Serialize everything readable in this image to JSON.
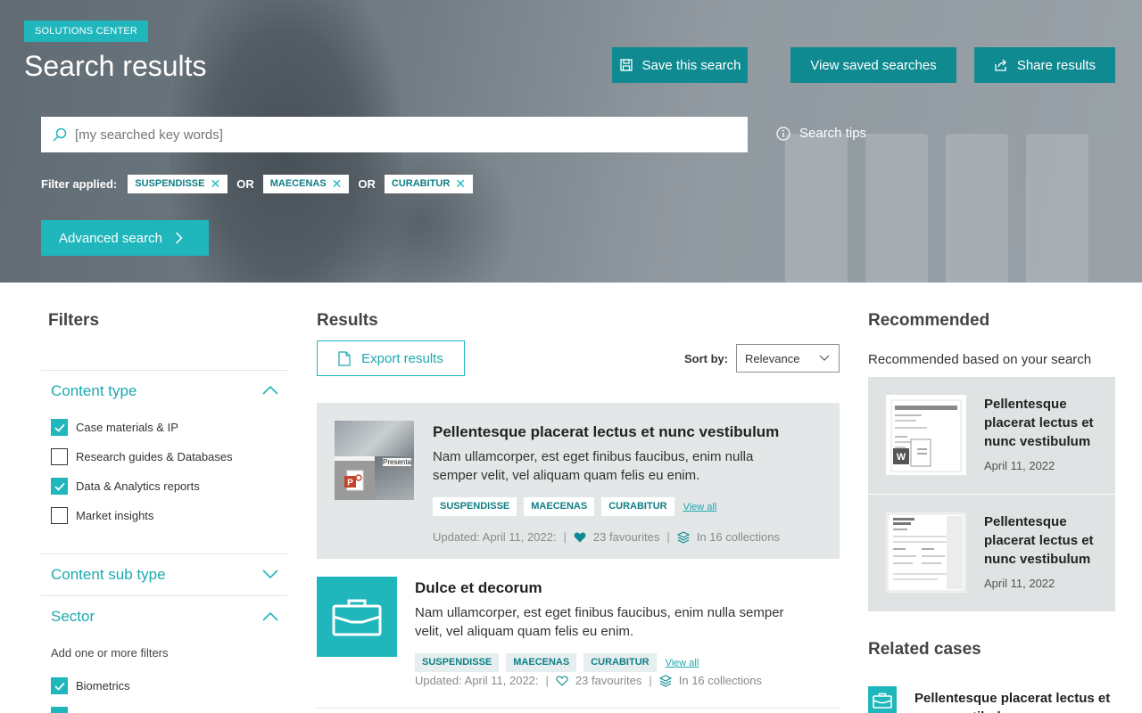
{
  "hero": {
    "badge": "SOLUTIONS CENTER",
    "title": "Search results",
    "buttons": {
      "save": "Save this search",
      "view_saved": "View saved searches",
      "share": "Share results"
    },
    "search": {
      "placeholder": "[my searched key words]"
    },
    "search_tips": "Search tips",
    "filter_label": "Filter applied:",
    "filters": [
      "SUSPENDISSE",
      "MAECENAS",
      "CURABITUR"
    ],
    "or": "OR",
    "advanced": "Advanced search"
  },
  "filters_panel": {
    "heading": "Filters",
    "content_type": {
      "label": "Content type",
      "options": [
        {
          "label": "Case materials & IP",
          "checked": true
        },
        {
          "label": "Research guides & Databases",
          "checked": false
        },
        {
          "label": "Data & Analytics reports",
          "checked": true
        },
        {
          "label": "Market insights",
          "checked": false
        }
      ]
    },
    "content_sub_type": {
      "label": "Content sub type"
    },
    "sector": {
      "label": "Sector",
      "hint": "Add one or more filters",
      "options": [
        {
          "label": "Biometrics",
          "checked": true
        }
      ]
    }
  },
  "results": {
    "heading": "Results",
    "export": "Export results",
    "sort_label": "Sort by:",
    "sort_value": "Relevance",
    "items": [
      {
        "title": "Pellentesque placerat lectus et nunc vestibulum",
        "desc_line1": "Nam ullamcorper, est eget finibus faucibus, enim nulla",
        "desc_line2": "semper velit, vel aliquam quam felis eu enim.",
        "thumb_text": "Presenta",
        "tags": [
          "SUSPENDISSE",
          "MAECENAS",
          "CURABITUR"
        ],
        "view_all": "View all",
        "updated": "Updated: April 11, 2022:",
        "favourites": "23 favourites",
        "collections": "In 16 collections"
      },
      {
        "title": "Dulce et decorum",
        "desc_line1": "Nam ullamcorper, est eget finibus faucibus, enim nulla semper",
        "desc_line2": "velit, vel aliquam quam felis eu enim.",
        "tags": [
          "SUSPENDISSE",
          "MAECENAS",
          "CURABITUR"
        ],
        "view_all": "View all",
        "updated": "Updated: April 11, 2022:",
        "favourites": "23 favourites",
        "collections": "In 16 collections"
      }
    ]
  },
  "recommended": {
    "heading": "Recommended",
    "subheading": "Recommended based on your search",
    "items": [
      {
        "title": "Pellentesque placerat lectus et nunc vestibulum",
        "date": "April 11, 2022"
      },
      {
        "title": "Pellentesque placerat lectus et nunc vestibulum",
        "date": "April 11, 2022"
      }
    ]
  },
  "related": {
    "heading": "Related cases",
    "items": [
      {
        "title": "Pellentesque placerat lectus et nunc vestibulum"
      }
    ]
  },
  "colors": {
    "accent": "#1fb6bc",
    "accent_dark": "#0f8a90",
    "accent_text": "#1ca9b0"
  }
}
